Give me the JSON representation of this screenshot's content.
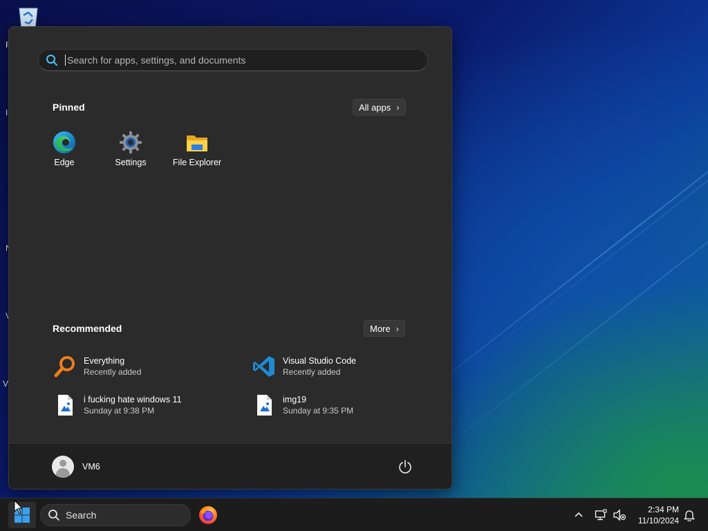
{
  "desktop": {
    "icons": [
      {
        "name": "recycle-bin-icon"
      }
    ],
    "letters": [
      "R",
      "I",
      "N",
      "V",
      "V"
    ]
  },
  "start_menu": {
    "search": {
      "placeholder": "Search for apps, settings, and documents",
      "icon": "search-icon"
    },
    "pinned": {
      "title": "Pinned",
      "all_apps_label": "All apps",
      "apps": [
        {
          "label": "Edge",
          "icon": "edge-icon"
        },
        {
          "label": "Settings",
          "icon": "settings-gear-icon"
        },
        {
          "label": "File Explorer",
          "icon": "folder-icon"
        }
      ]
    },
    "recommended": {
      "title": "Recommended",
      "more_label": "More",
      "items": [
        {
          "title": "Everything",
          "subtitle": "Recently added",
          "icon": "everything-search-icon"
        },
        {
          "title": "Visual Studio Code",
          "subtitle": "Recently added",
          "icon": "vscode-icon"
        },
        {
          "title": "i fucking hate windows 11",
          "subtitle": "Sunday at 9:38 PM",
          "icon": "image-file-icon"
        },
        {
          "title": "img19",
          "subtitle": "Sunday at 9:35 PM",
          "icon": "image-file-icon"
        }
      ]
    },
    "footer": {
      "user_name": "VM6",
      "power_icon": "power-icon"
    }
  },
  "taskbar": {
    "search_label": "Search",
    "pinned": [
      {
        "icon": "firefox-icon"
      }
    ],
    "tray": {
      "icons": [
        "chevron-up-icon",
        "network-icon",
        "volume-muted-icon",
        "notification-bell-icon"
      ],
      "time": "2:34 PM",
      "date": "11/10/2024"
    }
  },
  "colors": {
    "menu_bg": "#2b2b2b",
    "footer_bg": "#202020",
    "taskbar_bg": "#1c1c1c",
    "accent": "#0078d4"
  }
}
